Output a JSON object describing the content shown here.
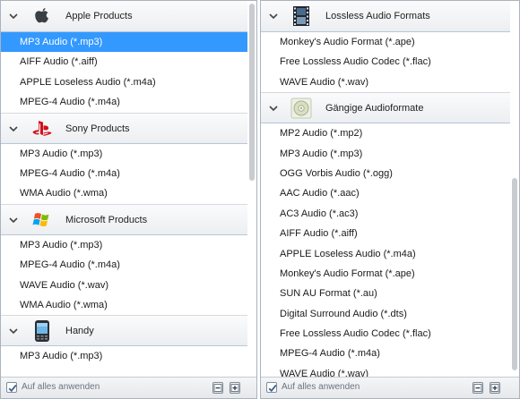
{
  "left_panel": {
    "groups": [
      {
        "label": "Apple Products",
        "icon": "apple-icon",
        "items": [
          "MP3 Audio (*.mp3)",
          "AIFF Audio (*.aiff)",
          "APPLE Loseless Audio (*.m4a)",
          "MPEG-4 Audio (*.m4a)"
        ]
      },
      {
        "label": "Sony Products",
        "icon": "playstation-icon",
        "items": [
          "MP3 Audio (*.mp3)",
          "MPEG-4 Audio (*.m4a)",
          "WMA Audio (*.wma)"
        ]
      },
      {
        "label": "Microsoft Products",
        "icon": "windows-icon",
        "items": [
          "MP3 Audio (*.mp3)",
          "MPEG-4 Audio (*.m4a)",
          "WAVE Audio (*.wav)",
          "WMA Audio (*.wma)"
        ]
      },
      {
        "label": "Handy",
        "icon": "mobile-phone-icon",
        "items": [
          "MP3 Audio (*.mp3)"
        ]
      }
    ],
    "selected_item": "MP3 Audio (*.mp3)",
    "footer": {
      "apply_all_label": "Auf alles anwenden",
      "apply_all_checked": true
    }
  },
  "right_panel": {
    "groups": [
      {
        "label": "Lossless Audio Formats",
        "icon": "film-strip-icon",
        "items": [
          "Monkey's Audio Format (*.ape)",
          "Free Lossless Audio Codec (*.flac)",
          "WAVE Audio (*.wav)"
        ]
      },
      {
        "label": "Gängige Audioformate",
        "icon": "audio-disc-icon",
        "items": [
          "MP2 Audio (*.mp2)",
          "MP3 Audio (*.mp3)",
          "OGG Vorbis Audio (*.ogg)",
          "AAC Audio (*.aac)",
          "AC3 Audio (*.ac3)",
          "AIFF Audio (*.aiff)",
          "APPLE Loseless Audio (*.m4a)",
          "Monkey's Audio Format (*.ape)",
          "SUN AU Format (*.au)",
          "Digital Surround Audio (*.dts)",
          "Free Lossless Audio Codec (*.flac)",
          "MPEG-4 Audio (*.m4a)",
          "WAVE Audio (*.wav)"
        ]
      }
    ],
    "footer": {
      "apply_all_label": "Auf alles anwenden",
      "apply_all_checked": true
    }
  },
  "colors": {
    "selection": "#3399ff",
    "header_rule": "#b7c7d8",
    "scroll_thumb": "#c8ccd1"
  }
}
